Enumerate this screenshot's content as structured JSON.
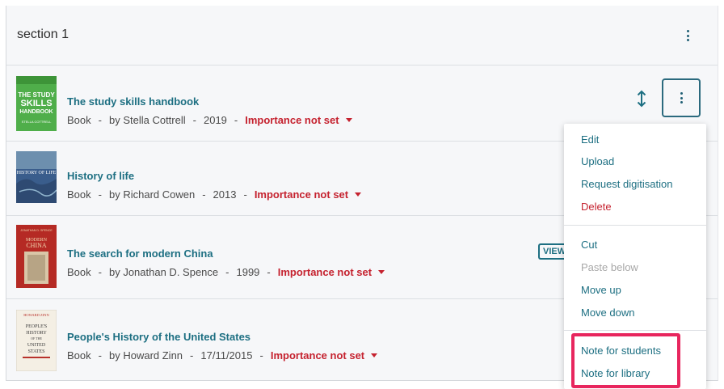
{
  "section": {
    "title": "section 1"
  },
  "items": [
    {
      "title": "The study skills handbook",
      "type": "Book",
      "author": "by Stella Cottrell",
      "date": "2019",
      "importance": "Importance not set"
    },
    {
      "title": "History of life",
      "type": "Book",
      "author": "by Richard Cowen",
      "date": "2013",
      "importance": "Importance not set"
    },
    {
      "title": "The search for modern China",
      "type": "Book",
      "author": "by Jonathan D. Spence",
      "date": "1999",
      "importance": "Importance not set"
    },
    {
      "title": "People's History of the United States",
      "type": "Book",
      "author": "by Howard Zinn",
      "date": "17/11/2015",
      "importance": "Importance not set"
    }
  ],
  "separator": "-",
  "view_chip": "VIEW",
  "menu": {
    "edit": "Edit",
    "upload": "Upload",
    "request_digitisation": "Request digitisation",
    "delete": "Delete",
    "cut": "Cut",
    "paste_below": "Paste below",
    "move_up": "Move up",
    "move_down": "Move down",
    "note_for_students": "Note for students",
    "note_for_library": "Note for library"
  },
  "covers": {
    "item0": {
      "top": "THE STUDY",
      "mid": "SKILLS",
      "bottom": "HANDBOOK",
      "author": "STELLA COTTRELL"
    },
    "item1": {
      "title": "HISTORY OF LIFE"
    },
    "item2": {
      "author": "JONATHAN D. SPENCE",
      "title1": "MODERN",
      "title2": "CHINA"
    },
    "item3": {
      "author": "HOWARD ZINN",
      "l1": "PEOPLE'S",
      "l2": "HISTORY",
      "l3": "OF THE",
      "l4": "UNITED",
      "l5": "STATES"
    }
  },
  "colors": {
    "accent": "#1d6f82",
    "danger": "#c5222f",
    "highlight": "#e8265e"
  }
}
